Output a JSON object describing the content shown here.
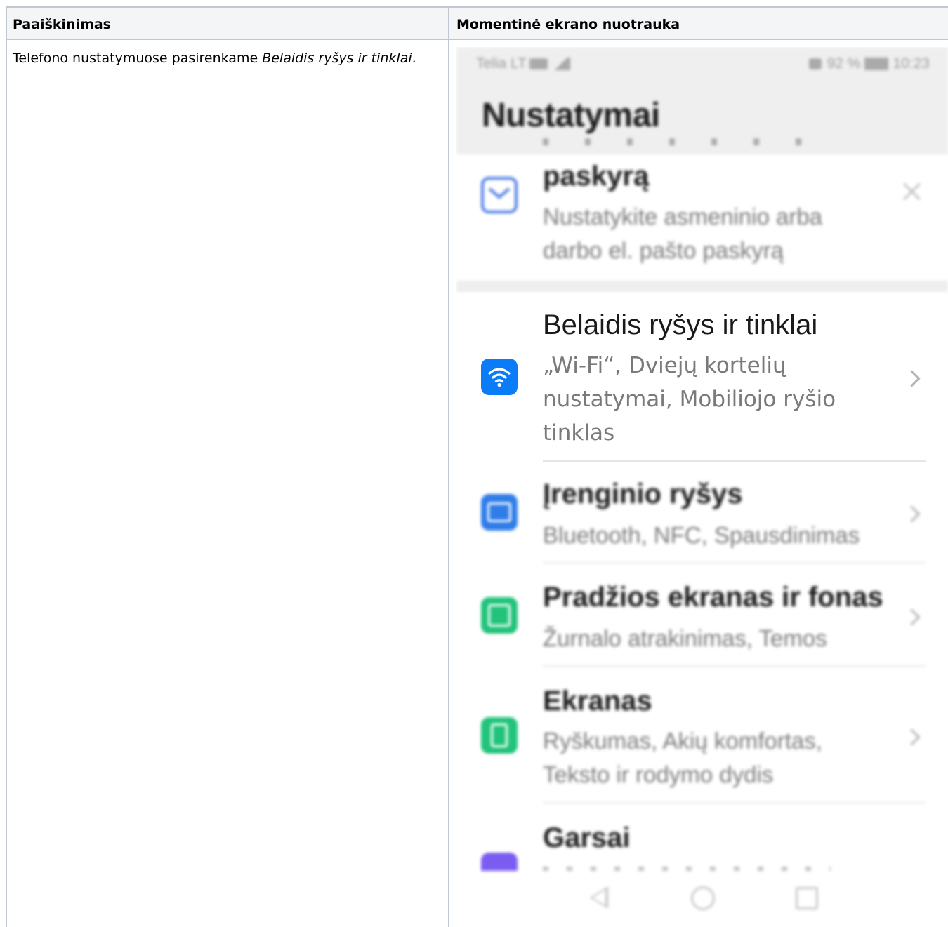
{
  "table": {
    "headers": [
      "Paaiškinimas",
      "Momentinė ekrano nuotrauka"
    ],
    "row": {
      "text_prefix": "Telefono nustatymuose pasirenkame ",
      "text_emphasis": "Belaidis ryšys ir tinklai",
      "text_suffix": "."
    }
  },
  "phone": {
    "status_bar": {
      "carrier": "Telia LT",
      "battery": "92 %",
      "time": "10:23"
    },
    "header_title": "Nustatymai",
    "items": [
      {
        "title": "paskyrą",
        "subtitle": "Nustatykite asmeninio arba darbo el. pašto paskyrą",
        "icon": "mail-icon",
        "color": "#4b7be8"
      },
      {
        "title": "Belaidis ryšys ir tinklai",
        "subtitle": "„Wi-Fi“, Dviejų kortelių nustatymai, Mobiliojo ryšio tinklas",
        "icon": "wifi-icon",
        "color": "#0a7cf7"
      },
      {
        "title": "Įrenginio ryšys",
        "subtitle": "Bluetooth, NFC, Spausdinimas",
        "icon": "device-connection-icon",
        "color": "#2f7de9"
      },
      {
        "title": "Pradžios ekranas ir fonas",
        "subtitle": "Žurnalo atrakinimas, Temos",
        "icon": "wallpaper-icon",
        "color": "#21c37a"
      },
      {
        "title": "Ekranas",
        "subtitle": "Ryškumas, Akių komfortas, Teksto ir rodymo dydis",
        "icon": "display-icon",
        "color": "#21c37a"
      },
      {
        "title": "Garsai",
        "subtitle": "",
        "icon": "sound-icon",
        "color": "#7b5cf0"
      }
    ]
  }
}
